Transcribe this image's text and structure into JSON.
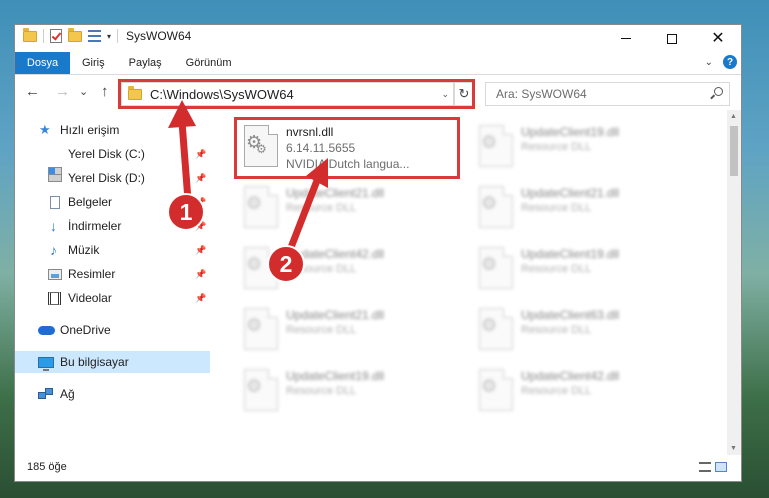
{
  "window": {
    "title": "SysWOW64",
    "controls": {
      "minimize": "minimize",
      "maximize": "maximize",
      "close": "✕"
    }
  },
  "ribbon": {
    "tabs": [
      "Dosya",
      "Giriş",
      "Paylaş",
      "Görünüm"
    ],
    "help": "?"
  },
  "navbar": {
    "back": "←",
    "forward": "→",
    "recent": "⌄",
    "up": "↑",
    "address": "C:\\Windows\\SysWOW64",
    "refresh": "↻",
    "search_placeholder": "Ara: SysWOW64"
  },
  "sidebar": {
    "items": [
      {
        "label": "Hızlı erişim",
        "icon": "star-icon"
      },
      {
        "label": "Yerel Disk (C:)",
        "icon": "drive-icon",
        "pinned": true
      },
      {
        "label": "Yerel Disk (D:)",
        "icon": "drive-icon",
        "pinned": true
      },
      {
        "label": "Belgeler",
        "icon": "document-icon",
        "pinned": true
      },
      {
        "label": "İndirmeler",
        "icon": "download-icon",
        "pinned": true
      },
      {
        "label": "Müzik",
        "icon": "music-icon",
        "pinned": true
      },
      {
        "label": "Resimler",
        "icon": "pictures-icon",
        "pinned": true
      },
      {
        "label": "Videolar",
        "icon": "videos-icon",
        "pinned": true
      },
      {
        "label": "OneDrive",
        "icon": "cloud-icon"
      },
      {
        "label": "Bu bilgisayar",
        "icon": "computer-icon",
        "selected": true
      },
      {
        "label": "Ağ",
        "icon": "network-icon"
      }
    ]
  },
  "files": {
    "highlighted": {
      "name": "nvrsnl.dll",
      "version": "6.14.11.5655",
      "description": "NVIDIA Dutch langua..."
    },
    "others": [
      {
        "name": "UpdateClient19.dll",
        "type": "Resource DLL"
      },
      {
        "name": "UpdateClient21.dll",
        "type": "Resource DLL"
      },
      {
        "name": "UpdateClient21.dll",
        "type": "Resource DLL"
      },
      {
        "name": "UpdateClient42.dll",
        "type": "Resource DLL"
      },
      {
        "name": "UpdateClient19.dll",
        "type": "Resource DLL"
      },
      {
        "name": "UpdateClient21.dll",
        "type": "Resource DLL"
      },
      {
        "name": "UpdateClient63.dll",
        "type": "Resource DLL"
      },
      {
        "name": "UpdateClient19.dll",
        "type": "Resource DLL"
      },
      {
        "name": "UpdateClient42.dll",
        "type": "Resource DLL"
      }
    ]
  },
  "status": {
    "count": "185 öğe"
  },
  "annotations": {
    "step1": "1",
    "step2": "2",
    "highlight_color": "#d93b3b"
  },
  "colors": {
    "accent": "#1979ca",
    "selection": "#cce8ff"
  }
}
